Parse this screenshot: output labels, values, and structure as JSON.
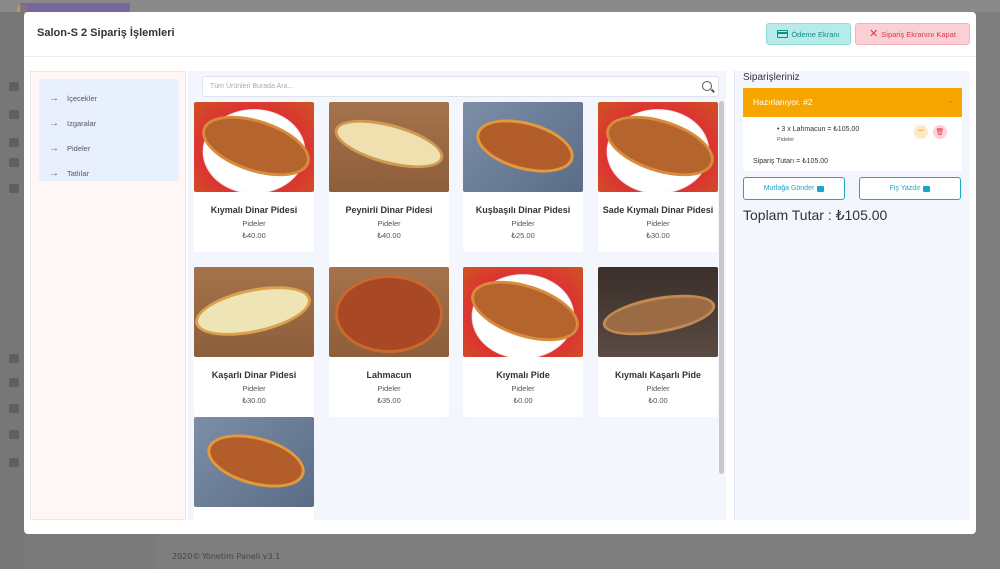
{
  "background": {
    "footer_year": "2020©",
    "footer_label": "Yönetim Paneli v3.1"
  },
  "modal": {
    "title": "Salon-S 2 Sipariş İşlemleri",
    "pay_button": "Ödeme Ekranı",
    "close_button": "Sipariş Ekranını Kapat"
  },
  "categories": [
    {
      "label": "İçecekler"
    },
    {
      "label": "Izgaralar"
    },
    {
      "label": "Pideler"
    },
    {
      "label": "Tatlılar"
    }
  ],
  "search": {
    "placeholder": "Tüm Ürünleri Burada Ara..."
  },
  "products": [
    {
      "name": "Kıymalı Dinar Pidesi",
      "category": "Pideler",
      "price": "₺40.00",
      "image": "plate"
    },
    {
      "name": "Peynirli Dinar Pidesi",
      "category": "Pideler",
      "price": "₺40.00",
      "image": "wood"
    },
    {
      "name": "Kuşbaşılı Dinar Pidesi",
      "category": "Pideler",
      "price": "₺25.00",
      "image": "blue"
    },
    {
      "name": "Sade Kıymalı Dinar Pidesi",
      "category": "Pideler",
      "price": "₺30.00",
      "image": "plate"
    },
    {
      "name": "Kaşarlı Dinar Pidesi",
      "category": "Pideler",
      "price": "₺30.00",
      "image": "veg"
    },
    {
      "name": "Lahmacun",
      "category": "Pideler",
      "price": "₺35.00",
      "image": "lahmacun"
    },
    {
      "name": "Kıymalı Pide",
      "category": "Pideler",
      "price": "₺0.00",
      "image": "plate"
    },
    {
      "name": "Kıymalı Kaşarlı Pide",
      "category": "Pideler",
      "price": "₺0.00",
      "image": "dark"
    },
    {
      "name": "",
      "category": "",
      "price": "",
      "image": "blue"
    }
  ],
  "orders": {
    "title": "Siparişleriniz",
    "status": "Hazırlanıyor. #2",
    "item_line": "3 x Lahmacun = ₺105.00",
    "item_category": "Pideler",
    "subtotal": "Sipariş Tutarı = ₺105.00",
    "kitchen_button": "Mutfağa Gönder",
    "receipt_button": "Fiş Yazdır",
    "total": "Toplam Tutar : ₺105.00"
  },
  "colors": {
    "accent_orange": "#f7a600",
    "accent_teal": "#1aa6c7",
    "danger": "#d9364a"
  }
}
